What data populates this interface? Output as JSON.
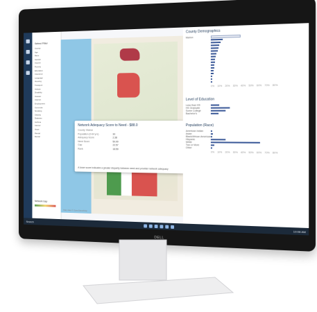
{
  "monitor": {
    "brand": "DELL"
  },
  "taskbar": {
    "search_label": "Search",
    "clock": "10:08 AM"
  },
  "filters": {
    "title": "Select Filter",
    "items": [
      "County",
      "Age",
      "Race",
      "Gender",
      "Income",
      "Poverty",
      "Education",
      "Insurance",
      "Language",
      "Housing",
      "Transport",
      "Vehicle",
      "Disability",
      "Veteran",
      "Internet",
      "Employment",
      "Commute",
      "Smoking",
      "Obesity",
      "Diabetes",
      "Asthma",
      "Cancer",
      "Heart",
      "Mental",
      "Dental"
    ],
    "legend_title": "Network Gap"
  },
  "map": {
    "colors": {
      "green": "#4e9b4e",
      "red": "#d9534f",
      "dark_red": "#b03a48",
      "yellow": "#e4cf5b"
    },
    "footer": "Map data © OpenStreetMap"
  },
  "popup": {
    "title": "Network Adequacy Score to Need - $88.0",
    "subtitle": "County: Marion",
    "rows": [
      {
        "label": "Population (0-64 yrs)",
        "value": "30"
      },
      {
        "label": "Adequacy Score",
        "value": "2.38"
      },
      {
        "label": "Need Score",
        "value": "50.00"
      },
      {
        "label": "Gap",
        "value": "22.57"
      },
      {
        "label": "Rank",
        "value": "18.59"
      }
    ],
    "note": "A lower score indicates a greater disparity between need and provider network adequacy"
  },
  "panel": {
    "demographics_title": "County Demographics",
    "demographics_rows": [
      "Marion",
      "",
      "",
      "",
      "",
      "",
      "",
      "",
      "",
      "",
      "",
      "",
      "",
      "",
      "",
      "",
      ""
    ],
    "demographics_values": [
      0.33,
      0.14,
      0.12,
      0.1,
      0.09,
      0.08,
      0.07,
      0.06,
      0.05,
      0.05,
      0.04,
      0.04,
      0.03,
      0.03,
      0.02,
      0.02,
      0.02
    ],
    "axis_ticks": [
      "0%",
      "10%",
      "20%",
      "30%",
      "40%",
      "50%",
      "60%",
      "70%",
      "80%"
    ],
    "education_title": "Level of Education",
    "education_rows": [
      {
        "label": "Less than HS",
        "value": 0.2
      },
      {
        "label": "HS Graduate",
        "value": 0.45
      },
      {
        "label": "Some College",
        "value": 0.35
      },
      {
        "label": "Bachelor's",
        "value": 0.18
      }
    ],
    "population_title": "Population (Race)",
    "population_rows": [
      {
        "label": "American Indian",
        "value": 0.03
      },
      {
        "label": "Asian",
        "value": 0.04
      },
      {
        "label": "Black/African American",
        "value": 0.02
      },
      {
        "label": "Hispanic",
        "value": 0.26
      },
      {
        "label": "White",
        "value": 0.86
      },
      {
        "label": "Two or More",
        "value": 0.06
      },
      {
        "label": "Other",
        "value": 0.03
      }
    ]
  }
}
